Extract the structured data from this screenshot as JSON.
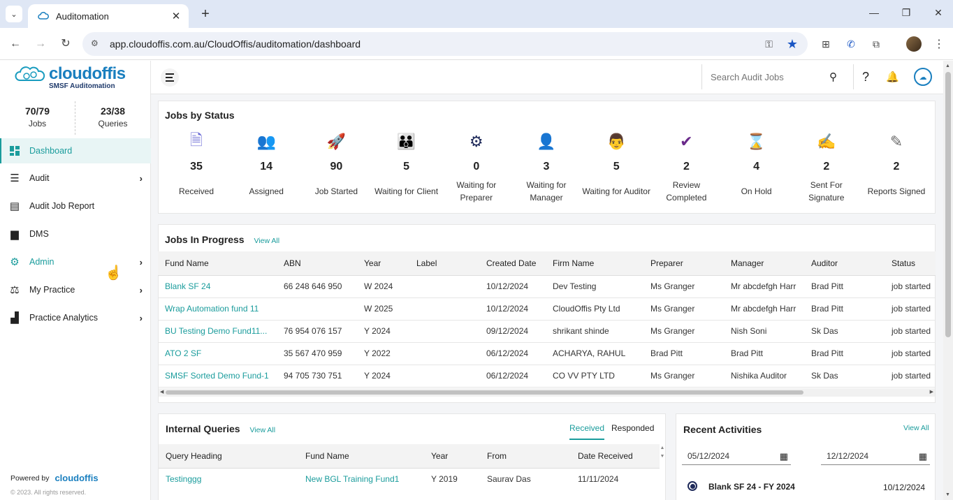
{
  "browser": {
    "tab_title": "Auditomation",
    "url": "app.cloudoffis.com.au/CloudOffis/auditomation/dashboard"
  },
  "app": {
    "logo_text": "cloudoffis",
    "logo_subtitle": "SMSF Auditomation",
    "search_placeholder": "Search Audit Jobs"
  },
  "sidebar": {
    "stats": [
      {
        "value": "70/79",
        "label": "Jobs"
      },
      {
        "value": "23/38",
        "label": "Queries"
      }
    ],
    "items": [
      {
        "label": "Dashboard",
        "icon": "dashboard-icon"
      },
      {
        "label": "Audit",
        "icon": "audit-icon"
      },
      {
        "label": "Audit Job Report",
        "icon": "report-icon"
      },
      {
        "label": "DMS",
        "icon": "document-icon"
      },
      {
        "label": "Admin",
        "icon": "gear-icon"
      },
      {
        "label": "My Practice",
        "icon": "practice-icon"
      },
      {
        "label": "Practice Analytics",
        "icon": "analytics-icon"
      }
    ],
    "powered_by": "Powered by",
    "powered_logo": "cloudoffis",
    "copyright": "© 2023. All rights reserved."
  },
  "jobs_by_status": {
    "title": "Jobs by Status",
    "items": [
      {
        "count": "35",
        "label": "Received",
        "icon": "received-icon",
        "color": "#6b6bd6"
      },
      {
        "count": "14",
        "label": "Assigned",
        "icon": "assigned-icon",
        "color": "#b06bd6"
      },
      {
        "count": "90",
        "label": "Job Started",
        "icon": "rocket-icon",
        "color": "#2a9fd6"
      },
      {
        "count": "5",
        "label": "Waiting for Client",
        "icon": "group-icon",
        "color": "#3cba6a"
      },
      {
        "count": "0",
        "label": "Waiting for Preparer",
        "icon": "preparer-icon",
        "color": "#1f2a5a"
      },
      {
        "count": "3",
        "label": "Waiting for Manager",
        "icon": "manager-icon",
        "color": "#f0a020"
      },
      {
        "count": "5",
        "label": "Waiting for Auditor",
        "icon": "auditor-icon",
        "color": "#7a9a7a"
      },
      {
        "count": "2",
        "label": "Review Completed",
        "icon": "review-icon",
        "color": "#6a2a8a"
      },
      {
        "count": "4",
        "label": "On Hold",
        "icon": "hourglass-icon",
        "color": "#c8a040"
      },
      {
        "count": "2",
        "label": "Sent For Signature",
        "icon": "signature-icon",
        "color": "#1f5a7a"
      },
      {
        "count": "2",
        "label": "Reports Signed",
        "icon": "signed-icon",
        "color": "#6a6a6a"
      }
    ]
  },
  "jobs_in_progress": {
    "title": "Jobs In Progress",
    "view_all": "View All",
    "columns": [
      "Fund Name",
      "ABN",
      "Year",
      "Label",
      "Created Date",
      "Firm Name",
      "Preparer",
      "Manager",
      "Auditor",
      "Status"
    ],
    "rows": [
      [
        "Blank SF 24",
        "66 248 646 950",
        "W 2024",
        "",
        "10/12/2024",
        "Dev Testing",
        "Ms Granger",
        "Mr abcdefgh Harr",
        "Brad Pitt",
        "job started"
      ],
      [
        "Wrap Automation fund 11",
        "",
        "W 2025",
        "",
        "10/12/2024",
        "CloudOffis Pty Ltd",
        "Ms Granger",
        "Mr abcdefgh Harr",
        "Brad Pitt",
        "job started"
      ],
      [
        "BU Testing Demo Fund11...",
        "76 954 076 157",
        "Y 2024",
        "",
        "09/12/2024",
        "shrikant shinde",
        "Ms Granger",
        "Nish Soni",
        "Sk Das",
        "job started"
      ],
      [
        "ATO 2 SF",
        "35 567 470 959",
        "Y 2022",
        "",
        "06/12/2024",
        "ACHARYA, RAHUL",
        "Brad Pitt",
        "Brad Pitt",
        "Brad Pitt",
        "job started"
      ],
      [
        "SMSF Sorted Demo Fund-1",
        "94 705 730 751",
        "Y 2024",
        "",
        "06/12/2024",
        "CO VV PTY LTD",
        "Ms Granger",
        "Nishika Auditor",
        "Sk Das",
        "job started"
      ]
    ]
  },
  "internal_queries": {
    "title": "Internal Queries",
    "view_all": "View All",
    "tabs": [
      "Received",
      "Responded"
    ],
    "columns": [
      "Query Heading",
      "Fund Name",
      "Year",
      "From",
      "Date Received"
    ],
    "rows": [
      [
        "Testinggg",
        "New BGL Training Fund1",
        "Y 2019",
        "Saurav Das",
        "11/11/2024"
      ]
    ]
  },
  "recent_activities": {
    "title": "Recent Activities",
    "view_all": "View All",
    "date_from": "05/12/2024",
    "date_to": "12/12/2024",
    "items": [
      {
        "title": "Blank SF 24 - FY 2024",
        "date": "10/12/2024"
      }
    ]
  }
}
